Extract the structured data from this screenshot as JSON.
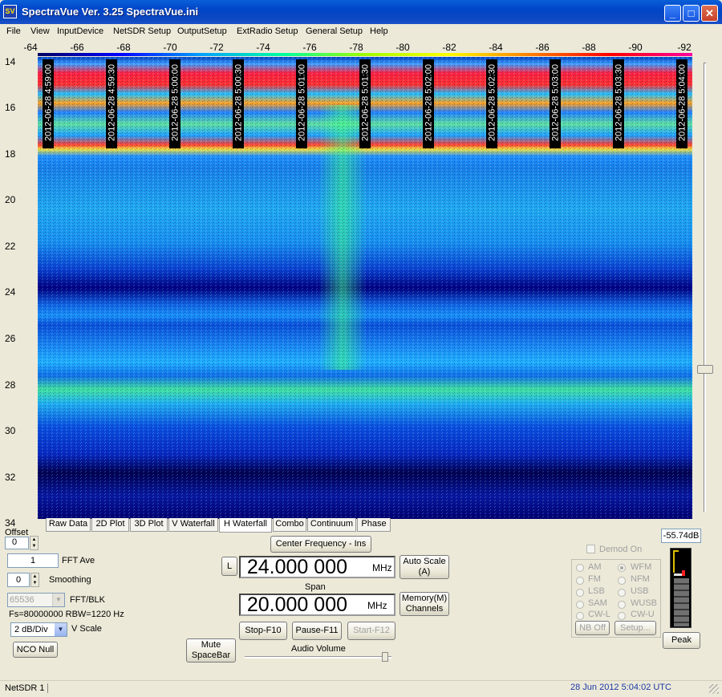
{
  "window": {
    "title": "SpectraVue Ver.  3.25  SpectraVue.ini",
    "icon_text": "SV",
    "minimize": "_",
    "maximize": "□",
    "close": "✕"
  },
  "menu": [
    "File",
    "View",
    "InputDevice",
    "NetSDR Setup",
    "OutputSetup",
    "ExtRadio Setup",
    "General Setup",
    "Help"
  ],
  "x_axis_ticks": [
    "-64",
    "-66",
    "-68",
    "-70",
    "-72",
    "-74",
    "-76",
    "-78",
    "-80",
    "-82",
    "-84",
    "-86",
    "-88",
    "-90",
    "-92"
  ],
  "y_axis_ticks": [
    "14",
    "16",
    "18",
    "20",
    "22",
    "24",
    "26",
    "28",
    "30",
    "32",
    "34"
  ],
  "timestamps": [
    "2012-06-28 4:59:00",
    "2012-06-28 4:59:30",
    "2012-06-28 5:00:00",
    "2012-06-28 5:00:30",
    "2012-06-28 5:01:00",
    "2012-06-28 5:01:30",
    "2012-06-28 5:02:00",
    "2012-06-28 5:02:30",
    "2012-06-28 5:03:00",
    "2012-06-28 5:03:30",
    "2012-06-28 5:04:00"
  ],
  "tabs": [
    "Raw Data",
    "2D Plot",
    "3D Plot",
    "V Waterfall",
    "H Waterfall",
    "Combo",
    "Continuum",
    "Phase"
  ],
  "active_tab": "H Waterfall",
  "controls": {
    "offset_label": "Offset",
    "offset_value": "0",
    "fft_ave_value": "1",
    "fft_ave_label": "FFT Ave",
    "smoothing_value": "0",
    "smoothing_label": "Smoothing",
    "fft_blk_value": "65536",
    "fft_blk_label": "FFT/BLK",
    "fs_info": "Fs=80000000 RBW=1220 Hz",
    "vscale_value": "2 dB/Div",
    "vscale_label": "V Scale",
    "nco_null": "NCO Null",
    "mute_line1": "Mute",
    "mute_line2": "SpaceBar",
    "center_freq_button": "Center Frequency - Ins",
    "l_button": "L",
    "center_freq_value": "24.000 000",
    "center_freq_unit": "MHz",
    "auto_scale_line1": "Auto Scale",
    "auto_scale_line2": "(A)",
    "span_label": "Span",
    "span_value": "20.000 000",
    "span_unit": "MHz",
    "memory_line1": "Memory(M)",
    "memory_line2": "Channels",
    "stop_button": "Stop-F10",
    "pause_button": "Pause-F11",
    "start_button": "Start-F12",
    "audio_volume_label": "Audio Volume",
    "level_readout": "-55.74dB",
    "peak_button": "Peak"
  },
  "demod": {
    "checkbox_label": "Demod On",
    "modes_left": [
      "AM",
      "FM",
      "LSB",
      "SAM",
      "CW-L"
    ],
    "modes_right": [
      "WFM",
      "NFM",
      "USB",
      "WUSB",
      "CW-U"
    ],
    "selected": "WFM",
    "nb_off": "NB Off",
    "setup": "Setup..."
  },
  "statusbar": {
    "device": "NetSDR 1",
    "datetime": "28 Jun 2012  5:04:02 UTC"
  },
  "colors": {
    "title_bar": "#0a5fd8",
    "status_time": "#1c3aa8"
  }
}
